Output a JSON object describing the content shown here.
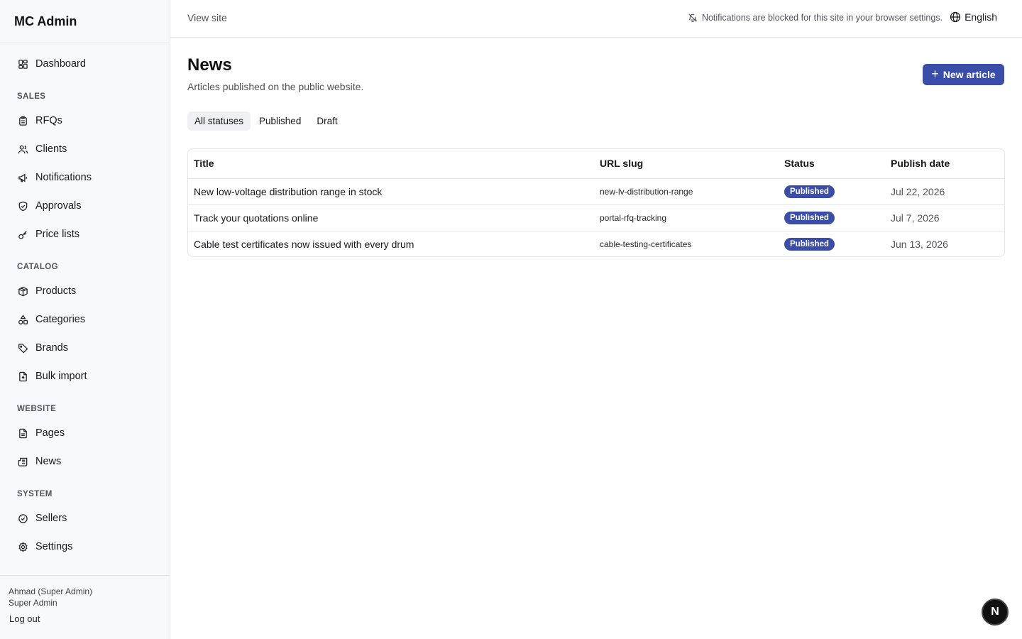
{
  "app": {
    "title": "MC Admin"
  },
  "sidebar": {
    "dashboard": "Dashboard",
    "sections": {
      "sales": "SALES",
      "catalog": "CATALOG",
      "website": "WEBSITE",
      "system": "SYSTEM"
    },
    "items": {
      "rfqs": "RFQs",
      "clients": "Clients",
      "notifications": "Notifications",
      "approvals": "Approvals",
      "price_lists": "Price lists",
      "products": "Products",
      "categories": "Categories",
      "brands": "Brands",
      "bulk_import": "Bulk import",
      "pages": "Pages",
      "news": "News",
      "sellers": "Sellers",
      "settings": "Settings"
    },
    "user": {
      "name": "Ahmad (Super Admin)",
      "role": "Super Admin",
      "logout": "Log out"
    }
  },
  "topbar": {
    "view_site": "View site",
    "notice": "Notifications are blocked for this site in your browser settings.",
    "language": "English"
  },
  "main": {
    "title": "News",
    "subtitle": "Articles published on the public website.",
    "new_button": "New article",
    "tabs": [
      "All statuses",
      "Published",
      "Draft"
    ],
    "table": {
      "headers": {
        "title": "Title",
        "slug": "URL slug",
        "status": "Status",
        "date": "Publish date"
      },
      "rows": [
        {
          "title": "New low-voltage distribution range in stock",
          "slug": "new-lv-distribution-range",
          "status": "Published",
          "date": "Jul 22, 2026"
        },
        {
          "title": "Track your quotations online",
          "slug": "portal-rfq-tracking",
          "status": "Published",
          "date": "Jul 7, 2026"
        },
        {
          "title": "Cable test certificates now issued with every drum",
          "slug": "cable-testing-certificates",
          "status": "Published",
          "date": "Jun 13, 2026"
        }
      ]
    }
  },
  "dev_badge": "N",
  "colors": {
    "accent": "#3a4da8",
    "sidebar_bg": "#f8f9fc"
  }
}
